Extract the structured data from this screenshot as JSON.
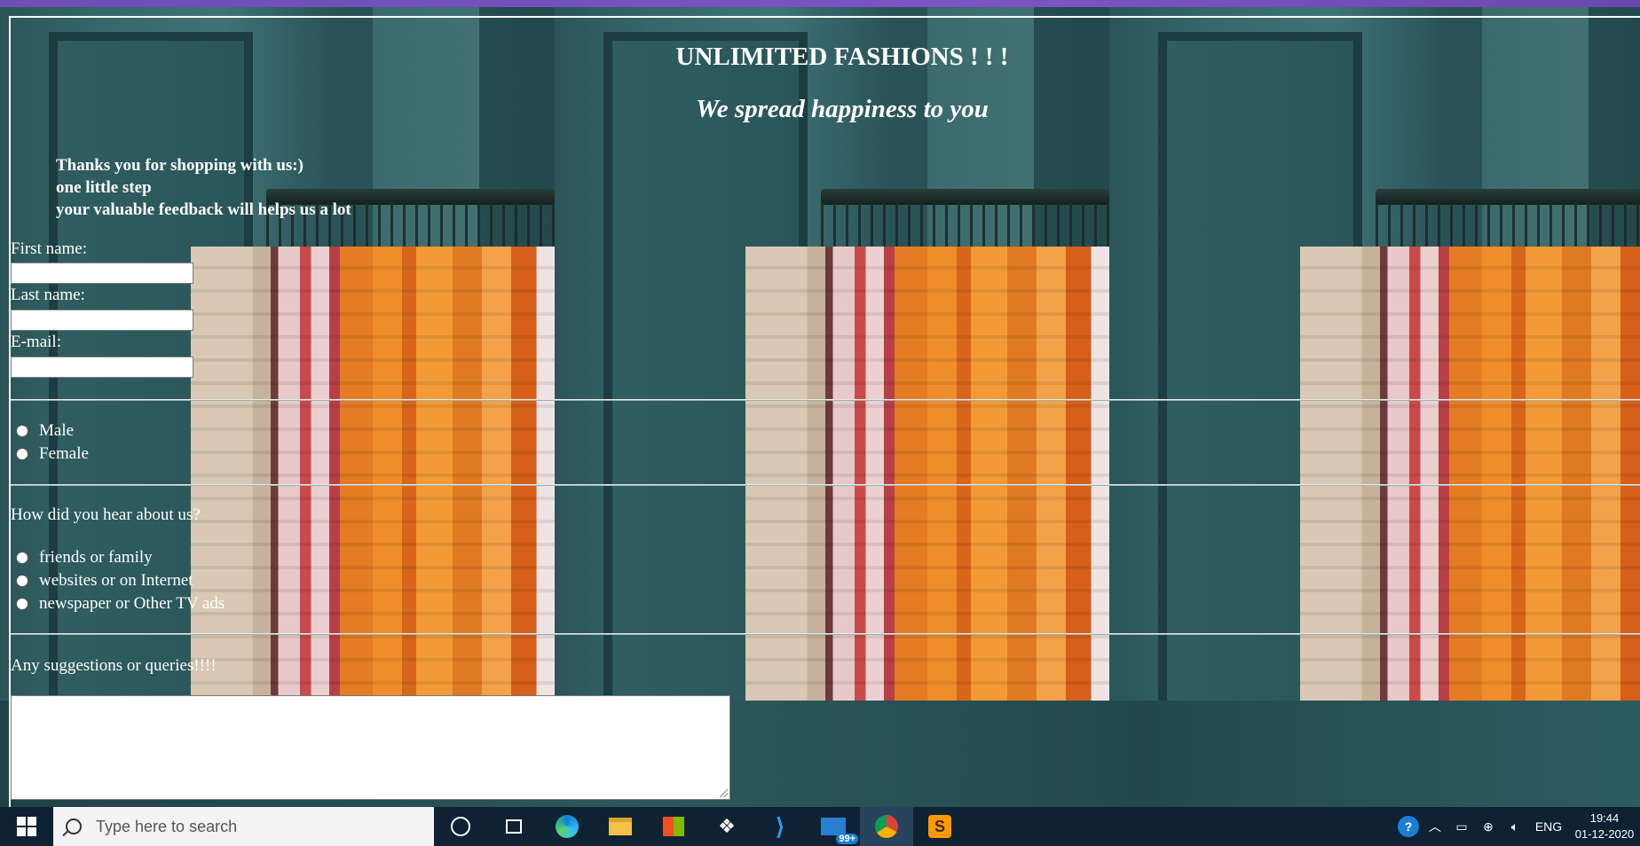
{
  "page": {
    "title": "UNLIMITED FASHIONS ! ! !",
    "tagline": "We spread happiness to you",
    "intro": [
      "Thanks you for shopping with us:)",
      "one little step",
      "your valuable feedback will helps us a lot"
    ]
  },
  "form": {
    "first_name_label": "First name:",
    "last_name_label": "Last name:",
    "email_label": "E-mail:",
    "first_name_value": "",
    "last_name_value": "",
    "email_value": "",
    "gender_options": [
      "Male",
      "Female"
    ],
    "hear_question": "How did you hear about us?",
    "hear_options": [
      "friends or family",
      "websites or on Internet",
      "newspaper or Other TV ads"
    ],
    "suggestions_label": "Any suggestions or queries!!!!",
    "suggestions_value": ""
  },
  "taskbar": {
    "search_placeholder": "Type here to search",
    "mail_badge": "99+",
    "language": "ENG",
    "time": "19:44",
    "date": "01-12-2020",
    "icons": [
      "windows-start-icon",
      "search-icon",
      "cortana-icon",
      "task-view-icon",
      "edge-icon",
      "file-explorer-icon",
      "store-icon",
      "dropbox-icon",
      "vscode-icon",
      "mail-icon",
      "chrome-icon",
      "sublime-icon",
      "help-icon",
      "chevron-up-icon",
      "battery-icon",
      "network-icon",
      "volume-icon"
    ]
  },
  "colors": {
    "accent_purple": "#6b4fb5",
    "taskbar": "#0f2233",
    "text": "#ffffff"
  }
}
